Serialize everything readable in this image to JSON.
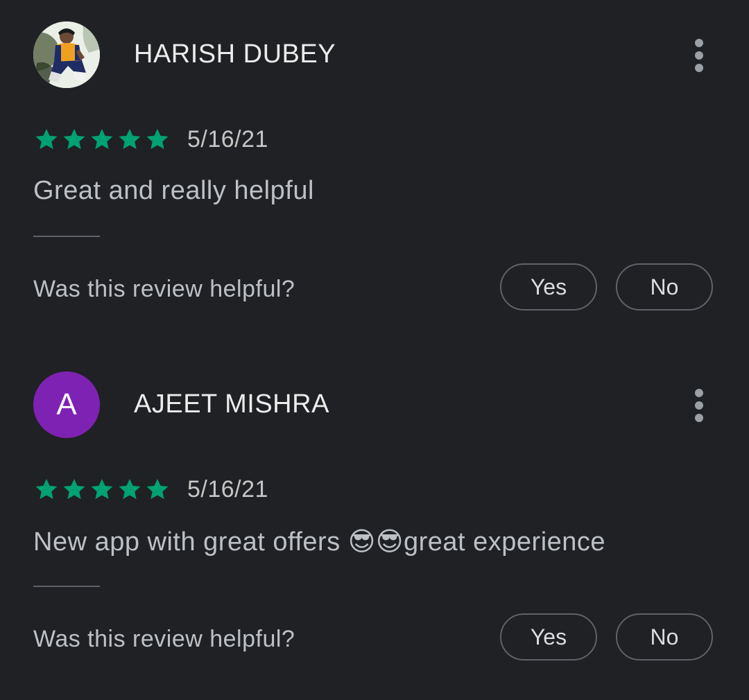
{
  "colors": {
    "background": "#202124",
    "star": "#00a173",
    "avatar_letter_bg": "#7e22b3"
  },
  "reviews": [
    {
      "name": "HARISH DUBEY",
      "avatar_type": "photo",
      "rating": 5,
      "date": "5/16/21",
      "text": "Great and really helpful",
      "helpful_prompt": "Was this review helpful?",
      "yes_label": "Yes",
      "no_label": "No"
    },
    {
      "name": "AJEET MISHRA",
      "avatar_type": "letter",
      "avatar_letter": "A",
      "rating": 5,
      "date": "5/16/21",
      "text": "New app with great offers 😎😎great experience",
      "helpful_prompt": "Was this review helpful?",
      "yes_label": "Yes",
      "no_label": "No"
    }
  ]
}
